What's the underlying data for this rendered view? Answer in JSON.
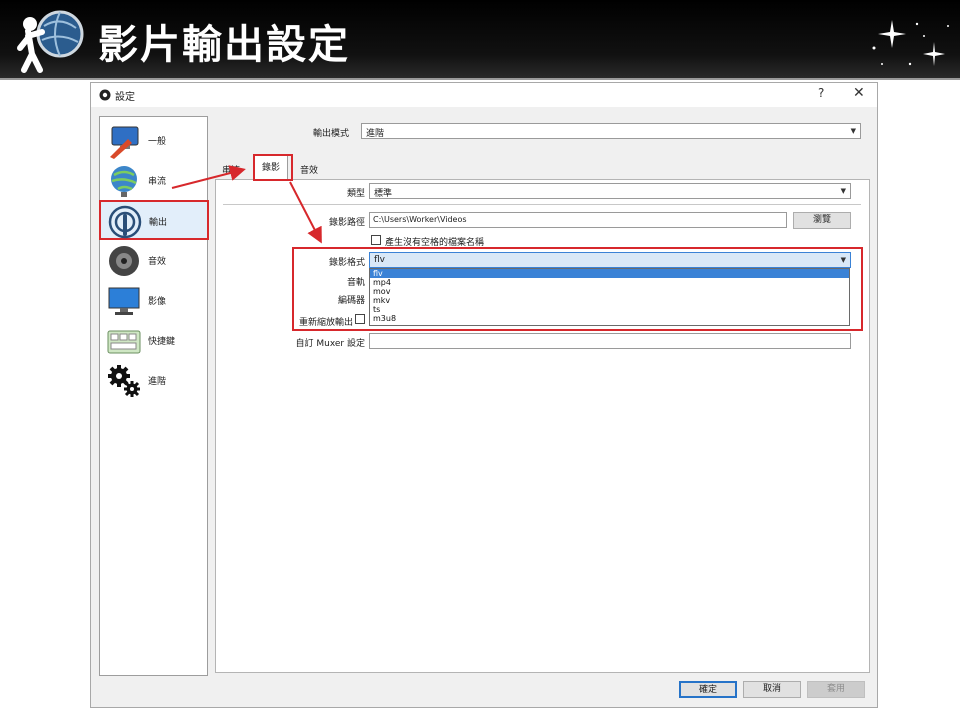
{
  "slide": {
    "title": "影片輸出設定"
  },
  "window": {
    "title": "設定",
    "help": "?",
    "close": "✕"
  },
  "sidebar": {
    "items": [
      {
        "label": "一般",
        "icon": "general-icon"
      },
      {
        "label": "串流",
        "icon": "stream-icon"
      },
      {
        "label": "輸出",
        "icon": "output-icon",
        "selected": true
      },
      {
        "label": "音效",
        "icon": "audio-icon"
      },
      {
        "label": "影像",
        "icon": "video-icon"
      },
      {
        "label": "快捷鍵",
        "icon": "hotkeys-icon"
      },
      {
        "label": "進階",
        "icon": "advanced-icon"
      }
    ]
  },
  "output_mode": {
    "label": "輸出模式",
    "value": "進階"
  },
  "tabs": [
    {
      "label": "串流"
    },
    {
      "label": "錄影",
      "active": true
    },
    {
      "label": "音效"
    }
  ],
  "recording": {
    "type": {
      "label": "類型",
      "value": "標準"
    },
    "path": {
      "label": "錄影路徑",
      "value": "C:\\Users\\Worker\\Videos",
      "browse": "瀏覽"
    },
    "no_space": {
      "label": "產生沒有空格的檔案名稱"
    },
    "format": {
      "label": "錄影格式",
      "value": "flv",
      "options": [
        "flv",
        "mp4",
        "mov",
        "mkv",
        "ts",
        "m3u8"
      ],
      "selected_index": 0
    },
    "audio_track_label": "音軌",
    "encoder_label": "編碼器",
    "rescale_label": "重新縮放輸出",
    "muxer": {
      "label": "自訂 Muxer 設定",
      "value": ""
    }
  },
  "footer": {
    "ok": "確定",
    "cancel": "取消",
    "apply": "套用"
  },
  "colors": {
    "highlight": "#d7282c",
    "selection": "#3a82d6",
    "header_bg": "#000000"
  }
}
